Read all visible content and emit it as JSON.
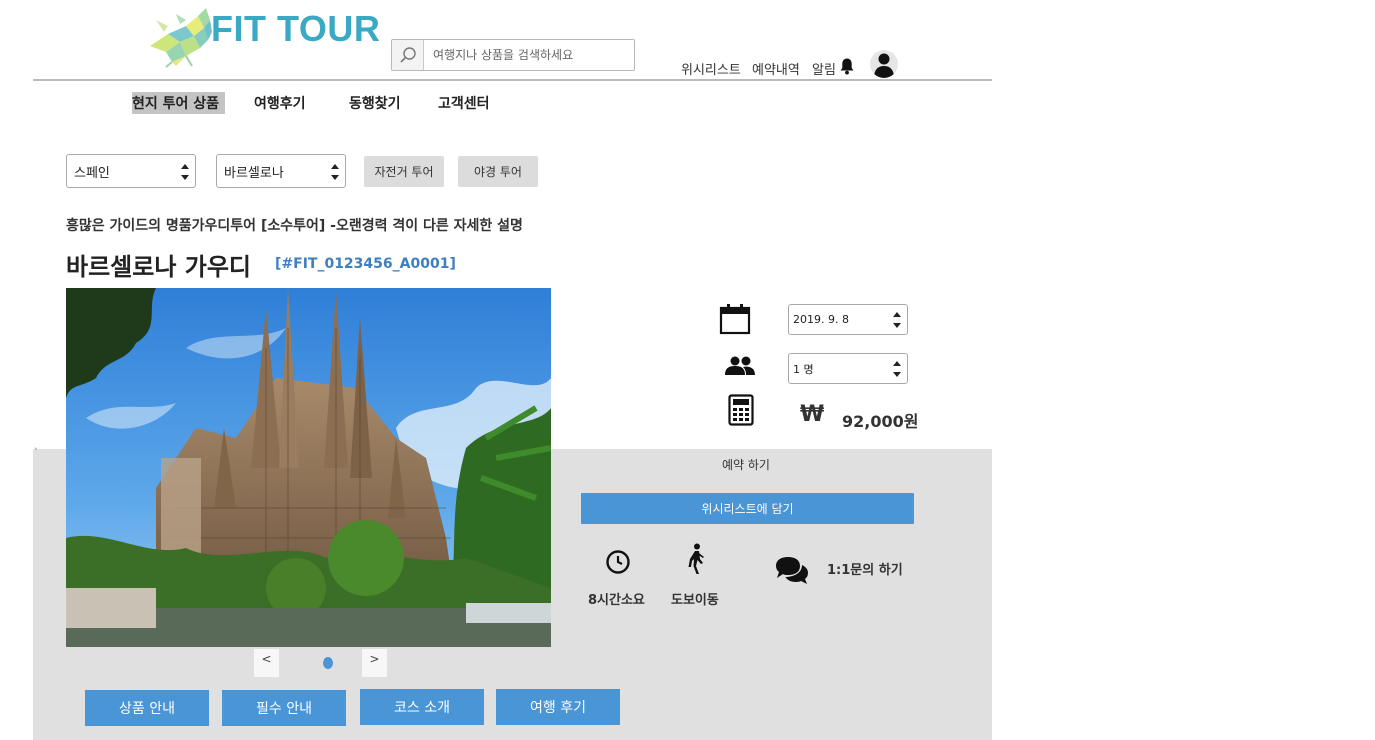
{
  "header": {
    "logo_text": "FIT TOUR",
    "search": {
      "placeholder": "여행지나 상품을 검색하세요",
      "value": ""
    },
    "links": {
      "wishlist": "위시리스트",
      "reservations": "예약내역",
      "notifications": "알림"
    }
  },
  "nav": {
    "items": [
      "현지 투어 상품",
      "여행후기",
      "동행찾기",
      "고객센터"
    ],
    "active_index": 0
  },
  "filters": {
    "country": "스페인",
    "city": "바르셀로나",
    "chips": [
      "자전거 투어",
      "야경 투어"
    ]
  },
  "product": {
    "subtitle": "흥많은 가이드의 명품가우디투어 [소수투어] -오랜경력 격이 다른 자세한 설명",
    "title": "바르셀로나 가우디",
    "code": "[#FIT_0123456_A0001]"
  },
  "booking": {
    "date": "2019. 9. 8",
    "people": "1 명",
    "currency_symbol": "₩",
    "price": "92,000원",
    "reserve_label": "예약 하기",
    "wishlist_button": "위시리스트에 담기"
  },
  "features": {
    "duration": "8시간소요",
    "transport": "도보이동",
    "inquiry": "1:1문의 하기"
  },
  "carousel": {
    "prev": "<",
    "next": ">"
  },
  "tabs": [
    "상품 안내",
    "필수 안내",
    "코스 소개",
    "여행 후기"
  ],
  "misc": {
    "tick": "`"
  },
  "colors": {
    "brand": "#3aa9c4",
    "accent": "#4a95d6",
    "code": "#3d7fc1",
    "panel": "#e0e0e0"
  }
}
